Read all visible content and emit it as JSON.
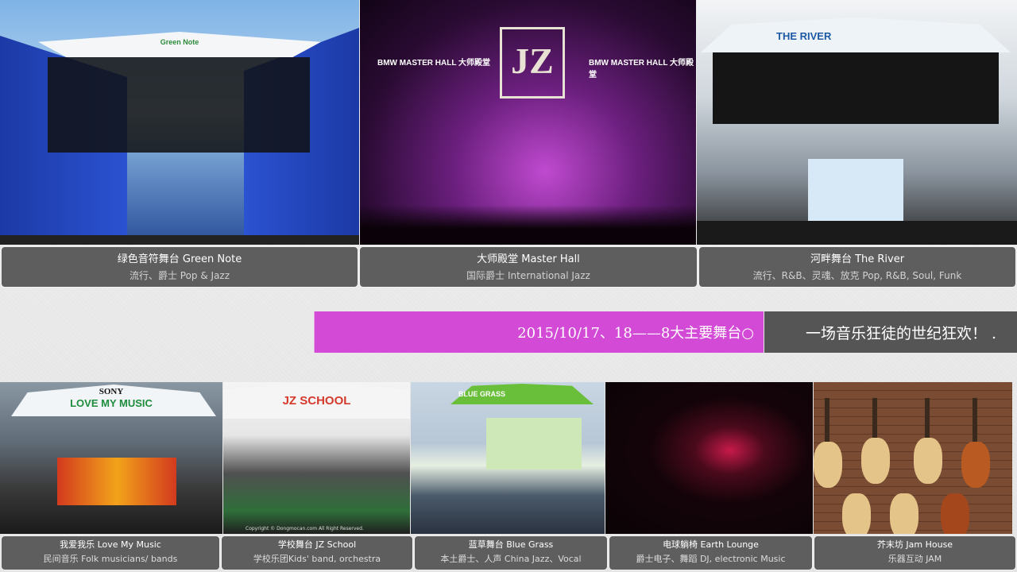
{
  "banner": {
    "date": "2015/10/17、18——8大主要舞台○",
    "tagline": "一场音乐狂徒的世纪狂欢！ ."
  },
  "photo_texts": {
    "green_note": "Green Note",
    "bmw_left": "BMW MASTER HALL 大师殿堂",
    "bmw_right": "BMW MASTER HALL 大师殿堂",
    "jz_logo": "JZ",
    "river": "THE RIVER",
    "sony": "SONY",
    "love_my_music": "LOVE MY MUSIC",
    "jz_school": "JZ SCHOOL",
    "school_watermark": "Copyright © Dongmocan.com All Right Reserved.",
    "blue_grass": "BLUE GRASS"
  },
  "stages_top": [
    {
      "name": "绿色音符舞台 Green Note",
      "genre": "流行、爵士 Pop & Jazz"
    },
    {
      "name": "大师殿堂 Master Hall",
      "genre": "国际爵士 International Jazz"
    },
    {
      "name": "河畔舞台 The River",
      "genre": "流行、R&B、灵魂、放克 Pop, R&B, Soul, Funk"
    }
  ],
  "stages_bottom": [
    {
      "name": "我爱我乐 Love My Music",
      "genre": "民间音乐 Folk musicians/ bands"
    },
    {
      "name": "学校舞台 JZ School",
      "genre": "学校乐团Kids' band, orchestra"
    },
    {
      "name": "蓝草舞台 Blue Grass",
      "genre": "本土爵士、人声 China Jazz、Vocal"
    },
    {
      "name": "电球躺椅 Earth Lounge",
      "genre": "爵士电子、舞蹈 DJ, electronic Music"
    },
    {
      "name": "芥末坊 Jam House",
      "genre": "乐器互动 JAM"
    }
  ]
}
